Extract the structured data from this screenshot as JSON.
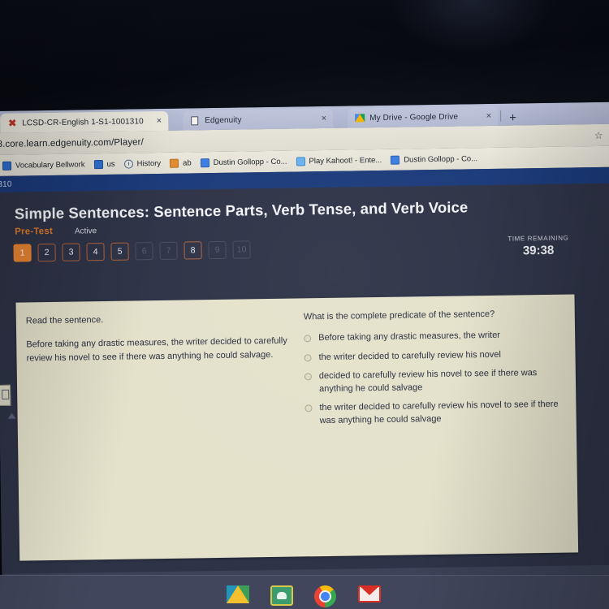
{
  "browser": {
    "tabs": [
      {
        "title": "LCSD-CR-English 1-S1-1001310",
        "favicon": "x-logo-icon",
        "active": true,
        "close": "×"
      },
      {
        "title": "Edgenuity",
        "favicon": "document-icon",
        "active": false,
        "close": "×"
      },
      {
        "title": "My Drive - Google Drive",
        "favicon": "google-drive-icon",
        "active": false,
        "close": "×"
      }
    ],
    "new_tab_label": "+",
    "url": "8.core.learn.edgenuity.com/Player/",
    "star_icon": "☆",
    "bookmarks": [
      {
        "label": "Vocabulary Bellwork",
        "icon": "blue-doc-icon"
      },
      {
        "label": "us",
        "icon": "blue-doc-icon"
      },
      {
        "label": "History",
        "icon": "clock-icon"
      },
      {
        "label": "ab",
        "icon": "orange-square-icon"
      },
      {
        "label": "Dustin Gollopp - Co...",
        "icon": "google-docs-icon"
      },
      {
        "label": "Play Kahoot! - Ente...",
        "icon": "kahoot-icon"
      },
      {
        "label": "Dustin Gollopp - Co...",
        "icon": "google-docs-icon"
      }
    ],
    "page_strip_text": "310"
  },
  "app": {
    "lesson_title": "Simple Sentences: Sentence Parts, Verb Tense, and Verb Voice",
    "assignment_type": "Pre-Test",
    "status": "Active",
    "questions": [
      {
        "number": "1",
        "state": "current"
      },
      {
        "number": "2",
        "state": "available"
      },
      {
        "number": "3",
        "state": "available"
      },
      {
        "number": "4",
        "state": "available"
      },
      {
        "number": "5",
        "state": "available"
      },
      {
        "number": "6",
        "state": "locked"
      },
      {
        "number": "7",
        "state": "locked"
      },
      {
        "number": "8",
        "state": "available"
      },
      {
        "number": "9",
        "state": "locked"
      },
      {
        "number": "10",
        "state": "locked"
      }
    ],
    "timer": {
      "label": "TIME REMAINING",
      "value": "39:38"
    },
    "content": {
      "instruction": "Read the sentence.",
      "passage": "Before taking any drastic measures, the writer decided to carefully review his novel to see if there was anything he could salvage.",
      "question": "What is the complete predicate of the sentence?",
      "options": [
        {
          "text": "Before taking any drastic measures, the writer",
          "selected": false
        },
        {
          "text": "the writer decided to carefully review his novel",
          "selected": false
        },
        {
          "text": "decided to carefully review his novel to see if there was anything he could salvage",
          "selected": false
        },
        {
          "text": "the writer decided to carefully review his novel to see if there was anything he could salvage",
          "selected": false
        }
      ]
    }
  },
  "taskbar": {
    "icons": [
      {
        "name": "google-drive-icon"
      },
      {
        "name": "google-classroom-icon"
      },
      {
        "name": "google-chrome-icon"
      },
      {
        "name": "gmail-icon"
      }
    ]
  },
  "cursor": {
    "name": "mouse-pointer"
  }
}
